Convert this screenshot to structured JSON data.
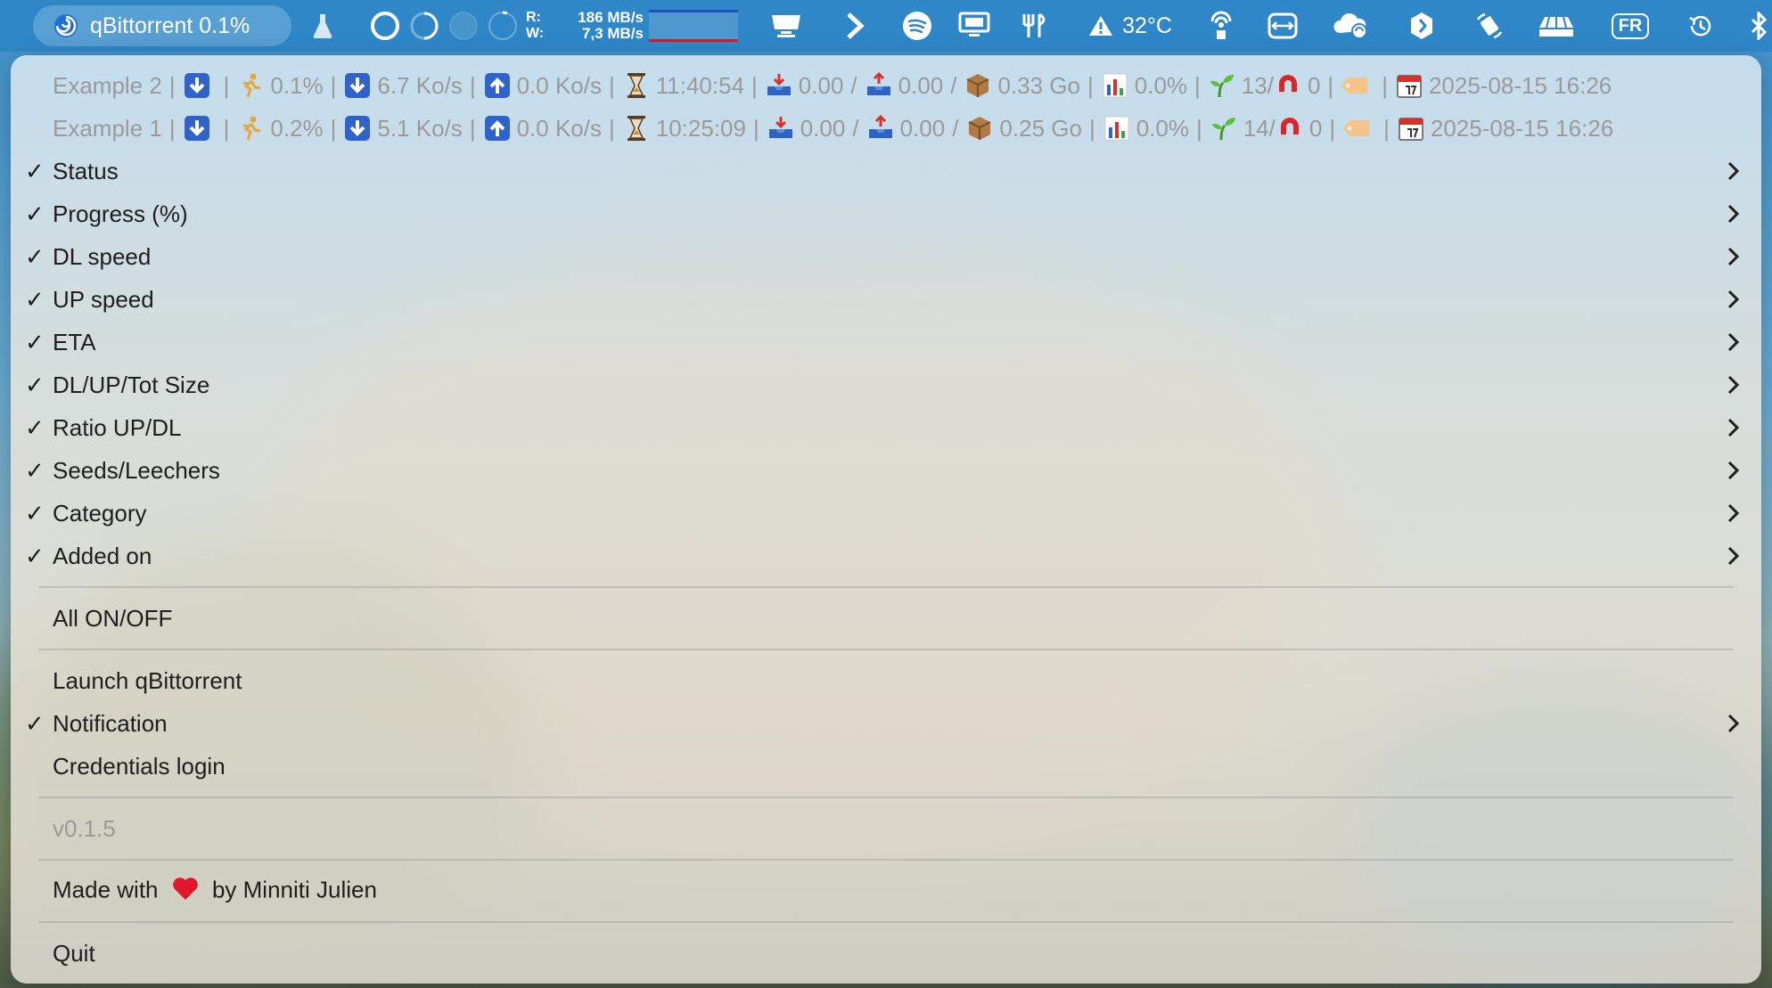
{
  "menubar": {
    "app_title": "qBittorrent 0.1%",
    "rw": {
      "r_label": "R:",
      "w_label": "W:",
      "r_value": "186 MB/s",
      "w_value": "7,3 MB/s"
    },
    "temperature": "32°C",
    "keyboard": "FR",
    "icons": [
      "swirl-icon",
      "flask-icon",
      "circle-icon",
      "spinner-icon",
      "dot-icon",
      "clock-arc-icon",
      "disk-graph-icon",
      "display-icon",
      "chevron-right-icon",
      "spotify-icon",
      "monitor-icon",
      "fork-icon",
      "warning-icon",
      "airdrop-icon",
      "remote-icon",
      "cloud-sync-icon",
      "bolt-icon",
      "rotate-icon",
      "airport-icon",
      "time-machine-icon",
      "bluetooth-icon"
    ]
  },
  "torrents": [
    {
      "name": "Example 2",
      "progress": "0.1%",
      "dl": "6.7 Ko/s",
      "ul": "0.0 Ko/s",
      "eta": "11:40:54",
      "downloaded": "0.00",
      "uploaded": "0.00",
      "total": "0.33 Go",
      "ratio": "0.0%",
      "seeds": "13/",
      "leechers": "0",
      "added": "2025-08-15 16:26"
    },
    {
      "name": "Example 1",
      "progress": "0.2%",
      "dl": "5.1 Ko/s",
      "ul": "0.0 Ko/s",
      "eta": "10:25:09",
      "downloaded": "0.00",
      "uploaded": "0.00",
      "total": "0.25 Go",
      "ratio": "0.0%",
      "seeds": "14/",
      "leechers": "0",
      "added": "2025-08-15 16:26"
    }
  ],
  "menu": {
    "columns": [
      {
        "label": "Status",
        "checked": true
      },
      {
        "label": "Progress (%)",
        "checked": true
      },
      {
        "label": "DL speed",
        "checked": true
      },
      {
        "label": "UP speed",
        "checked": true
      },
      {
        "label": "ETA",
        "checked": true
      },
      {
        "label": "DL/UP/Tot Size",
        "checked": true
      },
      {
        "label": "Ratio UP/DL",
        "checked": true
      },
      {
        "label": "Seeds/Leechers",
        "checked": true
      },
      {
        "label": "Category",
        "checked": true
      },
      {
        "label": "Added on",
        "checked": true
      }
    ],
    "check_mark": "✓",
    "all_toggle": "All ON/OFF",
    "launch": "Launch qBittorrent",
    "notification": "Notification",
    "credentials": "Credentials login",
    "version": "v0.1.5",
    "made_with_prefix": "Made with",
    "made_with_suffix": "by Minniti Julien",
    "quit": "Quit",
    "separator_char": "|",
    "slash": "/"
  },
  "colors": {
    "menubar_bg": "#2f87c8",
    "menu_text": "#1e1e1e",
    "disabled_text": "#9a9a9a",
    "heart": "#e0182d"
  }
}
